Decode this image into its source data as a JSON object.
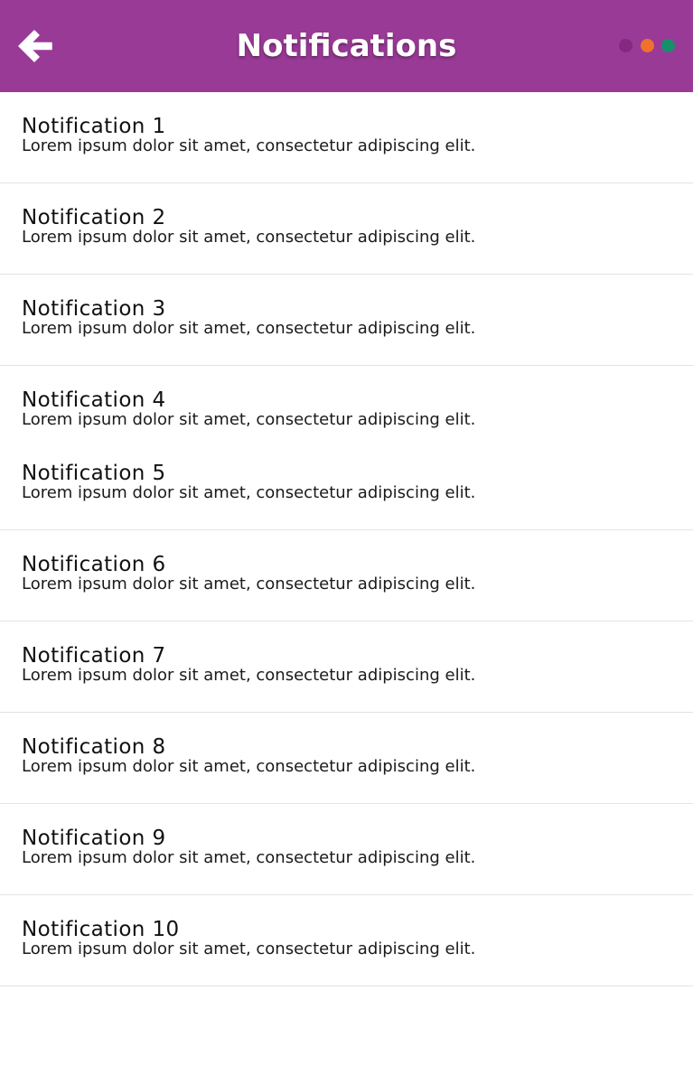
{
  "header": {
    "title": "Notifications",
    "background_color": "#993a96",
    "back_icon": "arrow-left-icon",
    "menu_dots": [
      {
        "name": "purple-dot",
        "color": "#85287f"
      },
      {
        "name": "orange-dot",
        "color": "#f0712c"
      },
      {
        "name": "green-dot",
        "color": "#16906a"
      }
    ]
  },
  "notifications": [
    {
      "title": "Notification 1",
      "body": "Lorem ipsum dolor sit amet, consectetur adipiscing elit."
    },
    {
      "title": "Notification 2",
      "body": "Lorem ipsum dolor sit amet, consectetur adipiscing elit."
    },
    {
      "title": "Notification 3",
      "body": "Lorem ipsum dolor sit amet, consectetur adipiscing elit."
    },
    {
      "title": "Notification 4",
      "body": "Lorem ipsum dolor sit amet, consectetur adipiscing elit."
    },
    {
      "title": "Notification 5",
      "body": "Lorem ipsum dolor sit amet, consectetur adipiscing elit."
    },
    {
      "title": "Notification 6",
      "body": "Lorem ipsum dolor sit amet, consectetur adipiscing elit."
    },
    {
      "title": "Notification 7",
      "body": "Lorem ipsum dolor sit amet, consectetur adipiscing elit."
    },
    {
      "title": "Notification 8",
      "body": "Lorem ipsum dolor sit amet, consectetur adipiscing elit."
    },
    {
      "title": "Notification 9",
      "body": "Lorem ipsum dolor sit amet, consectetur adipiscing elit."
    },
    {
      "title": "Notification 10",
      "body": "Lorem ipsum dolor sit amet, consectetur adipiscing elit."
    }
  ]
}
